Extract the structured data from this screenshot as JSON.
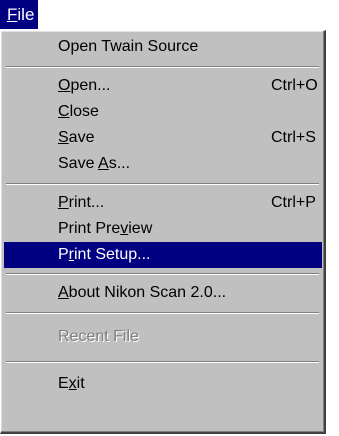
{
  "menubar": {
    "file": {
      "pre": "",
      "key": "F",
      "post": "ile"
    }
  },
  "menu": {
    "items": [
      {
        "pre": "Open Twain Source",
        "key": "",
        "post": "",
        "shortcut": ""
      },
      {
        "pre": "",
        "key": "O",
        "post": "pen...",
        "shortcut": "Ctrl+O"
      },
      {
        "pre": "",
        "key": "C",
        "post": "lose",
        "shortcut": ""
      },
      {
        "pre": "",
        "key": "S",
        "post": "ave",
        "shortcut": "Ctrl+S"
      },
      {
        "pre": "Save ",
        "key": "A",
        "post": "s...",
        "shortcut": ""
      },
      {
        "pre": "",
        "key": "P",
        "post": "rint...",
        "shortcut": "Ctrl+P"
      },
      {
        "pre": "Print Pre",
        "key": "v",
        "post": "iew",
        "shortcut": ""
      },
      {
        "pre": "P",
        "key": "r",
        "post": "int Setup...",
        "shortcut": "",
        "state": "selected"
      },
      {
        "pre": "",
        "key": "A",
        "post": "bout Nikon Scan 2.0...",
        "shortcut": ""
      },
      {
        "pre": "Recent File",
        "key": "",
        "post": "",
        "shortcut": "",
        "state": "disabled"
      },
      {
        "pre": "E",
        "key": "x",
        "post": "it",
        "shortcut": ""
      }
    ]
  },
  "colors": {
    "menu_background": "#c0c0c0",
    "highlight": "#000080",
    "highlight_text": "#ffffff",
    "disabled_text": "#808080"
  }
}
